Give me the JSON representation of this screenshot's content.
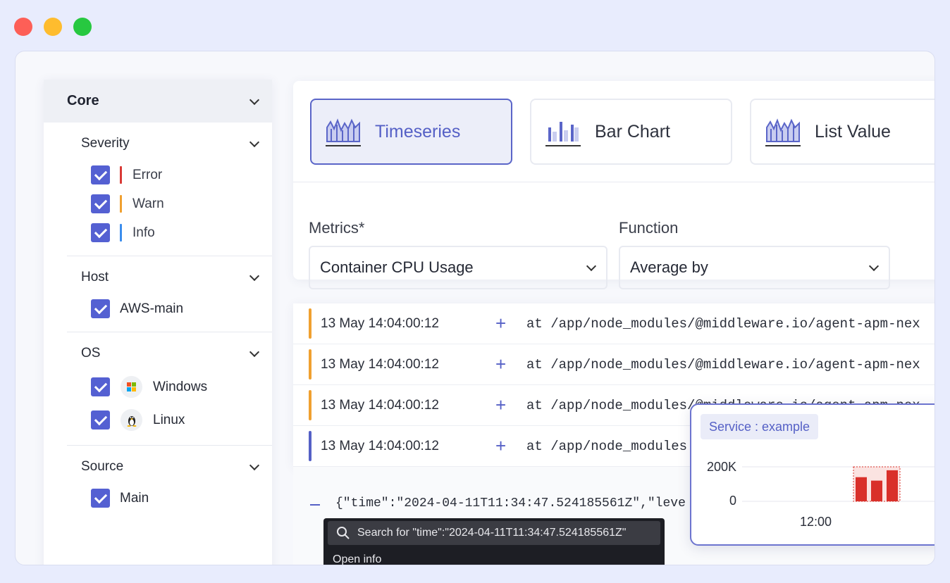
{
  "window_controls": [
    "close",
    "minimize",
    "maximize"
  ],
  "sidebar": {
    "core": {
      "label": "Core"
    },
    "severity": {
      "label": "Severity",
      "items": [
        {
          "label": "Error",
          "checked": true,
          "color": "#d93a36"
        },
        {
          "label": "Warn",
          "checked": true,
          "color": "#f0a030"
        },
        {
          "label": "Info",
          "checked": true,
          "color": "#3b8ded"
        }
      ]
    },
    "host": {
      "label": "Host",
      "items": [
        {
          "label": "AWS-main",
          "checked": true
        }
      ]
    },
    "os": {
      "label": "OS",
      "items": [
        {
          "label": "Windows",
          "checked": true,
          "icon": "windows-icon"
        },
        {
          "label": "Linux",
          "checked": true,
          "icon": "linux-icon"
        }
      ]
    },
    "source": {
      "label": "Source",
      "items": [
        {
          "label": "Main",
          "checked": true
        }
      ]
    }
  },
  "viz": {
    "types": [
      {
        "label": "Timeseries",
        "active": true,
        "icon": "timeseries-icon"
      },
      {
        "label": "Bar Chart",
        "active": false,
        "icon": "bar-chart-icon"
      },
      {
        "label": "List Value",
        "active": false,
        "icon": "list-value-icon"
      }
    ],
    "metrics": {
      "label": "Metrics*",
      "value": "Container CPU Usage"
    },
    "function": {
      "label": "Function",
      "value": "Average by"
    }
  },
  "logs": {
    "rows": [
      {
        "timestamp": "13 May 14:04:00:12",
        "message": "at /app/node_modules/@middleware.io/agent-apm-nex",
        "color": "#f0a030"
      },
      {
        "timestamp": "13 May 14:04:00:12",
        "message": "at /app/node_modules/@middleware.io/agent-apm-nex",
        "color": "#f0a030"
      },
      {
        "timestamp": "13 May 14:04:00:12",
        "message": "at /app/node_modules/@middleware.io/agent-apm-nex",
        "color": "#f0a030"
      },
      {
        "timestamp": "13 May 14:04:00:12",
        "message": "at /app/node_modules",
        "color": "#5560c6"
      }
    ],
    "expanded_json": "{\"time\":\"2024-04-11T11:34:47.524185561Z\",\"leve"
  },
  "context_menu": {
    "search_label": "Search for \"time\":\"2024-04-11T11:34:47.524185561Z\"",
    "open_info": "Open info"
  },
  "popup": {
    "chip": "Service : example",
    "accent": "#d9302a"
  },
  "chart_data": {
    "type": "bar",
    "categories": [
      "12:00"
    ],
    "series": [
      {
        "values": [
          140000,
          120000,
          180000
        ]
      }
    ],
    "y_ticks": [
      "200K",
      "0"
    ],
    "x_ticks": [
      "12:00"
    ],
    "ylim": [
      0,
      200000
    ],
    "grid": true
  }
}
